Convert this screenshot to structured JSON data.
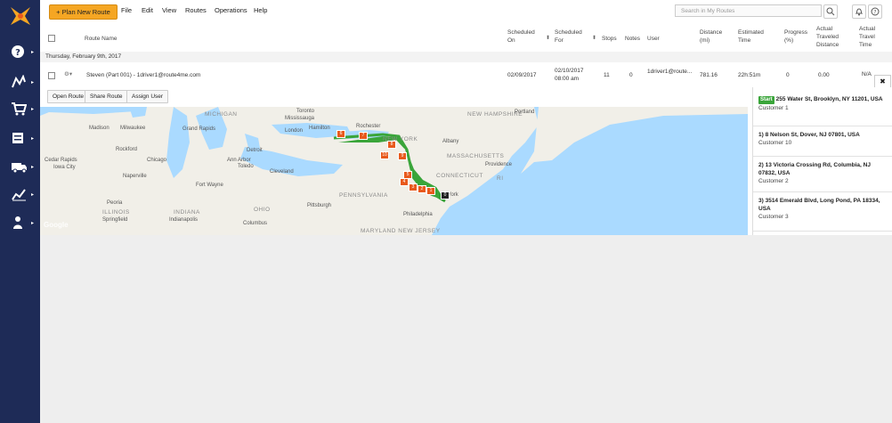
{
  "topbar": {
    "plan_button": "+ Plan New Route",
    "menu": [
      "File",
      "Edit",
      "View",
      "Routes",
      "Operations",
      "Help"
    ],
    "search_placeholder": "Search in My Routes"
  },
  "columns": {
    "route_name": "Route Name",
    "scheduled_on": [
      "Scheduled",
      "On"
    ],
    "scheduled_for": [
      "Scheduled",
      "For"
    ],
    "stops": "Stops",
    "notes": "Notes",
    "user": "User",
    "distance": [
      "Distance",
      "(mi)"
    ],
    "estimated_time": [
      "Estimated",
      "Time"
    ],
    "progress": [
      "Progress",
      "(%)"
    ],
    "actual_distance": [
      "Actual",
      "Traveled",
      "Distance"
    ],
    "actual_time": [
      "Actual",
      "Travel",
      "Time"
    ]
  },
  "group": {
    "label": "Thursday, February 9th, 2017"
  },
  "route": {
    "name": "Steven (Part 001) - 1driver1@route4me.com",
    "scheduled_on": "02/09/2017",
    "scheduled_for_date": "02/10/2017",
    "scheduled_for_time": "08:00 am",
    "stops": "11",
    "notes": "0",
    "user": "1driver1@route...",
    "distance": "781.16",
    "estimated_time": "22h:51m",
    "progress": "0",
    "actual_distance": "0.00",
    "actual_time": "N/A"
  },
  "panel_tabs": [
    "Open Route",
    "Share Route",
    "Assign User"
  ],
  "map": {
    "labels": {
      "michigan": "MICHIGAN",
      "mississauga": "Mississauga",
      "toronto": "Toronto",
      "hamilton": "Hamilton",
      "london": "London",
      "madison": "Madison",
      "milwaukee": "Milwaukee",
      "grand_rapids": "Grand Rapids",
      "rockford": "Rockford",
      "detroit": "Detroit",
      "chicago": "Chicago",
      "ann_arbor": "Ann Arbor",
      "toledo": "Toledo",
      "cleveland": "Cleveland",
      "cedar_rapids": "Cedar Rapids",
      "iowa_city": "Iowa City",
      "naperville": "Naperville",
      "fort_wayne": "Fort Wayne",
      "peoria": "Peoria",
      "pittsburgh": "Pittsburgh",
      "illinois": "ILLINOIS",
      "springfield": "Springfield",
      "indiana": "INDIANA",
      "indianapolis": "Indianapolis",
      "ohio": "OHIO",
      "columbus": "Columbus",
      "pennsylvania": "PENNSYLVANIA",
      "philadelphia": "Philadelphia",
      "new_york": "NEW YORK",
      "rochester": "Rochester",
      "albany": "Albany",
      "new_hampshire": "NEW HAMPSHIRE",
      "portland": "Portland",
      "massachusetts": "MASSACHUSETTS",
      "providence": "Providence",
      "connecticut": "CONNECTICUT",
      "ri": "RI",
      "maryland_nj": "MARYLAND  NEW JERSEY",
      "york": "York",
      "google": "Google"
    },
    "markers": [
      "6",
      "7",
      "8",
      "9",
      "10",
      "5",
      "4",
      "3",
      "2",
      "1",
      "0"
    ]
  },
  "stops": [
    {
      "badge": "Start",
      "address": "255 Water St, Brooklyn, NY 11201, USA",
      "name": "Customer 1"
    },
    {
      "badge": "",
      "address": "1) 8 Nelson St, Dover, NJ 07801, USA",
      "name": "Customer 10"
    },
    {
      "badge": "",
      "address": "2) 13 Victoria Crossing Rd, Columbia, NJ 07832, USA",
      "name": "Customer 2"
    },
    {
      "badge": "",
      "address": "3) 3514 Emerald Blvd, Long Pond, PA 18334, USA",
      "name": "Customer 3"
    }
  ],
  "colors": {
    "sidebar": "#1e2b57",
    "accent": "#f5a623",
    "route_line": "#3aa53a",
    "marker": "#e8591c"
  },
  "icons": [
    "logo-icon",
    "help-icon",
    "routes-icon",
    "cart-icon",
    "orders-icon",
    "truck-icon",
    "analytics-icon",
    "users-icon",
    "search-icon",
    "bell-icon",
    "info-icon",
    "gear-icon",
    "close-icon"
  ]
}
